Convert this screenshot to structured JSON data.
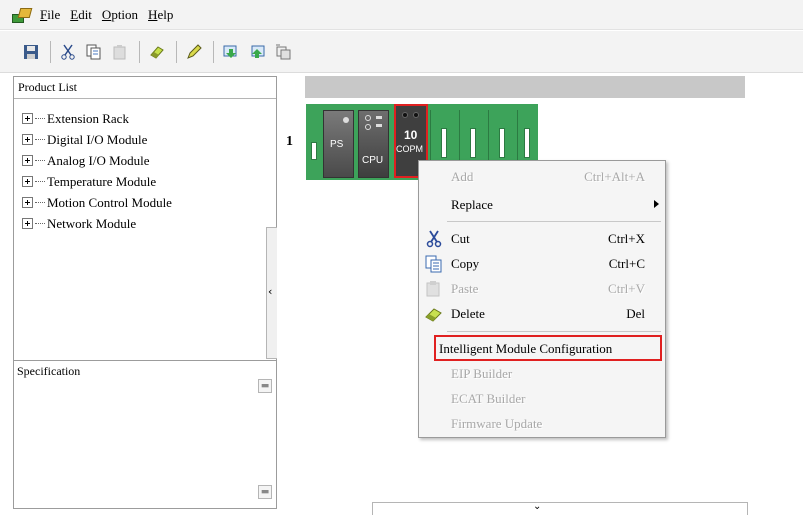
{
  "menubar": {
    "items": [
      {
        "pre": "",
        "u": "F",
        "post": "ile"
      },
      {
        "pre": "",
        "u": "E",
        "post": "dit"
      },
      {
        "pre": "",
        "u": "O",
        "post": "ption"
      },
      {
        "pre": "",
        "u": "H",
        "post": "elp"
      }
    ]
  },
  "product_list": {
    "header": "Product List",
    "items": [
      "Extension Rack",
      "Digital I/O Module",
      "Analog I/O Module",
      "Temperature Module",
      "Motion Control Module",
      "Network Module"
    ]
  },
  "specification": {
    "header": "Specification"
  },
  "rack": {
    "number": "1",
    "ps_label": "PS",
    "cpu_label": "CPU",
    "copm_number": "10",
    "copm_label": "COPM"
  },
  "context_menu": {
    "items": [
      {
        "label": "Add",
        "shortcut": "Ctrl+Alt+A",
        "enabled": false
      },
      {
        "label": "Replace",
        "shortcut": "",
        "enabled": true,
        "submenu": true
      },
      {
        "label": "Cut",
        "shortcut": "Ctrl+X",
        "enabled": true,
        "icon": "scissors-icon"
      },
      {
        "label": "Copy",
        "shortcut": "Ctrl+C",
        "enabled": true,
        "icon": "copy-icon"
      },
      {
        "label": "Paste",
        "shortcut": "Ctrl+V",
        "enabled": false,
        "icon": "paste-icon"
      },
      {
        "label": "Delete",
        "shortcut": "Del",
        "enabled": true,
        "icon": "eraser-icon"
      },
      {
        "label": "Intelligent Module Configuration",
        "shortcut": "",
        "enabled": true,
        "highlighted": true
      },
      {
        "label": "EIP Builder",
        "shortcut": "",
        "enabled": false
      },
      {
        "label": "ECAT Builder",
        "shortcut": "",
        "enabled": false
      },
      {
        "label": "Firmware Update",
        "shortcut": "",
        "enabled": false
      }
    ]
  },
  "colors": {
    "rack_green": "#3da35a",
    "highlight_red": "#e02020",
    "disabled_text": "#a8a8a8"
  }
}
